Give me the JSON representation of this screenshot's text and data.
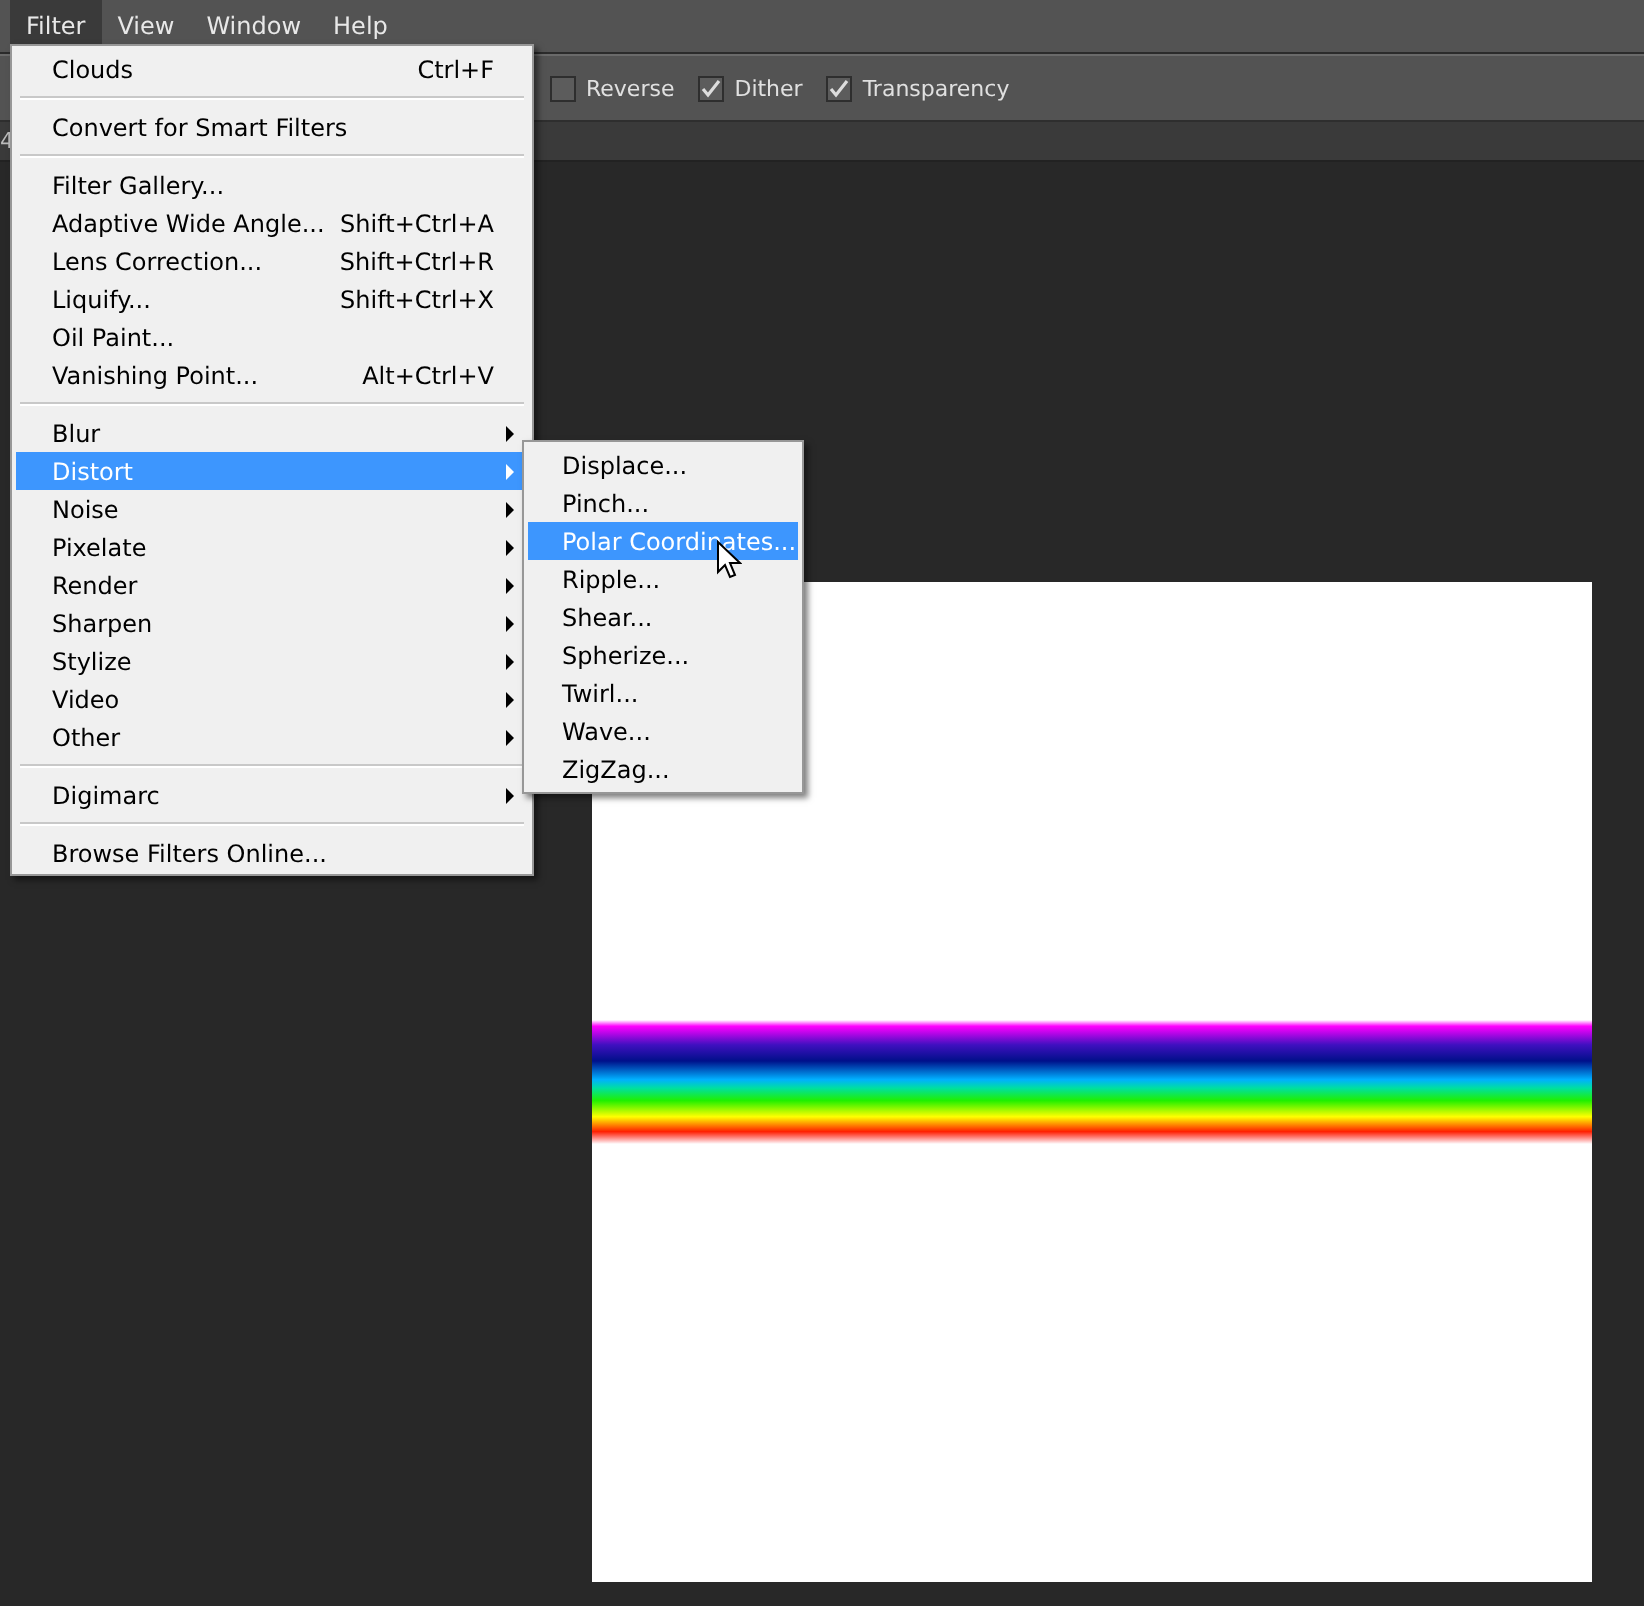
{
  "menu_bar": [
    {
      "label": "Filter",
      "selected": true
    },
    {
      "label": "View",
      "selected": false
    },
    {
      "label": "Window",
      "selected": false
    },
    {
      "label": "Help",
      "selected": false
    }
  ],
  "options_bar": {
    "checkboxes": [
      {
        "label": "Reverse",
        "checked": false
      },
      {
        "label": "Dither",
        "checked": true
      },
      {
        "label": "Transparency",
        "checked": true
      }
    ]
  },
  "tab_bar": {
    "tab_fragment": "4"
  },
  "filter_menu": {
    "sections": [
      [
        {
          "label": "Clouds",
          "shortcut": "Ctrl+F",
          "submenu": false,
          "selected": false
        }
      ],
      [
        {
          "label": "Convert for Smart Filters",
          "submenu": false,
          "selected": false
        }
      ],
      [
        {
          "label": "Filter Gallery...",
          "submenu": false,
          "selected": false
        },
        {
          "label": "Adaptive Wide Angle...",
          "shortcut": "Shift+Ctrl+A",
          "submenu": false,
          "selected": false
        },
        {
          "label": "Lens Correction...",
          "shortcut": "Shift+Ctrl+R",
          "submenu": false,
          "selected": false
        },
        {
          "label": "Liquify...",
          "shortcut": "Shift+Ctrl+X",
          "submenu": false,
          "selected": false
        },
        {
          "label": "Oil Paint...",
          "submenu": false,
          "selected": false
        },
        {
          "label": "Vanishing Point...",
          "shortcut": "Alt+Ctrl+V",
          "submenu": false,
          "selected": false
        }
      ],
      [
        {
          "label": "Blur",
          "submenu": true,
          "selected": false
        },
        {
          "label": "Distort",
          "submenu": true,
          "selected": true
        },
        {
          "label": "Noise",
          "submenu": true,
          "selected": false
        },
        {
          "label": "Pixelate",
          "submenu": true,
          "selected": false
        },
        {
          "label": "Render",
          "submenu": true,
          "selected": false
        },
        {
          "label": "Sharpen",
          "submenu": true,
          "selected": false
        },
        {
          "label": "Stylize",
          "submenu": true,
          "selected": false
        },
        {
          "label": "Video",
          "submenu": true,
          "selected": false
        },
        {
          "label": "Other",
          "submenu": true,
          "selected": false
        }
      ],
      [
        {
          "label": "Digimarc",
          "submenu": true,
          "selected": false
        }
      ],
      [
        {
          "label": "Browse Filters Online...",
          "submenu": false,
          "selected": false
        }
      ]
    ]
  },
  "distort_submenu": {
    "items": [
      {
        "label": "Displace...",
        "selected": false
      },
      {
        "label": "Pinch...",
        "selected": false
      },
      {
        "label": "Polar Coordinates...",
        "selected": true
      },
      {
        "label": "Ripple...",
        "selected": false
      },
      {
        "label": "Shear...",
        "selected": false
      },
      {
        "label": "Spherize...",
        "selected": false
      },
      {
        "label": "Twirl...",
        "selected": false
      },
      {
        "label": "Wave...",
        "selected": false
      },
      {
        "label": "ZigZag...",
        "selected": false
      }
    ]
  }
}
